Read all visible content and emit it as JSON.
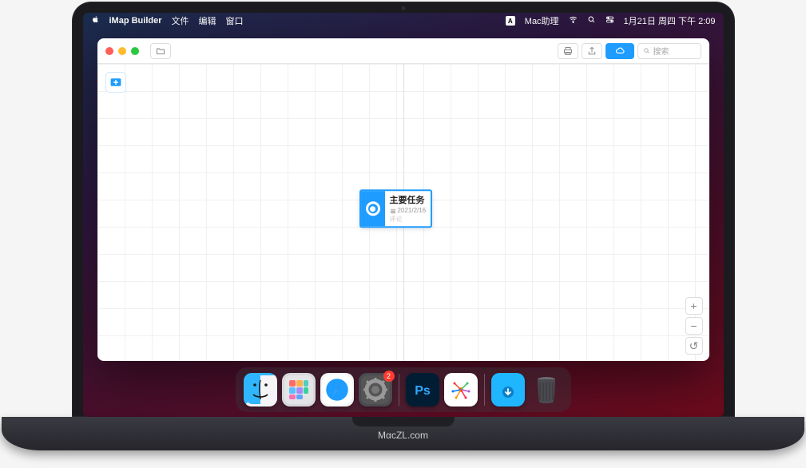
{
  "menubar": {
    "app_name": "iMap Builder",
    "menus": [
      "文件",
      "编辑",
      "窗口"
    ],
    "status_input": "A",
    "status_helper": "Mac助理",
    "datetime": "1月21日 周四 下午 2:09"
  },
  "titlebar": {
    "search_placeholder": "搜索"
  },
  "node": {
    "title": "主要任务",
    "date": "2021/2/16",
    "comment": "评论"
  },
  "zoom": {
    "plus": "+",
    "minus": "−",
    "reset": "↺"
  },
  "dock": {
    "settings_badge": "2"
  },
  "laptop": {
    "footer_label": "MαcZL.com"
  }
}
